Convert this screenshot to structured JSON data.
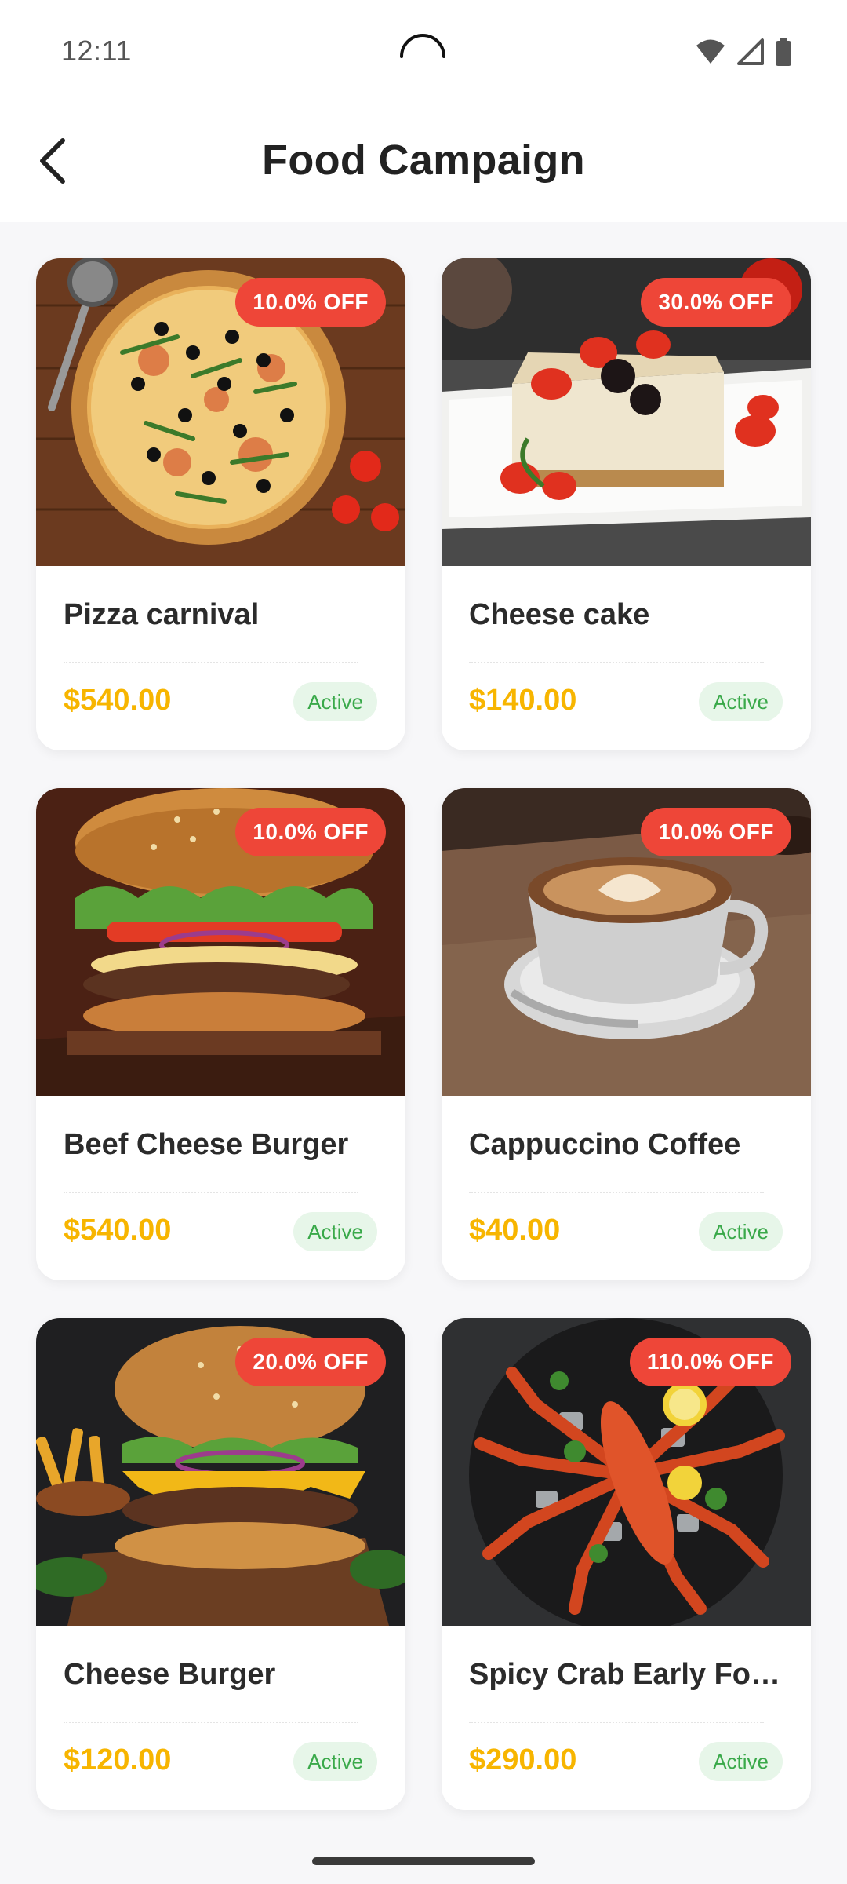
{
  "status_bar": {
    "time": "12:11",
    "icons": [
      "wifi-icon",
      "signal-icon",
      "battery-icon"
    ]
  },
  "header": {
    "title": "Food Campaign",
    "back_icon": "back-arrow-icon"
  },
  "colors": {
    "discount_badge": "#ee4638",
    "price": "#f7b500",
    "status_text": "#3aa94a",
    "status_bg": "#e7f6e9"
  },
  "campaigns": [
    {
      "name": "Pizza carnival",
      "discount": "10.0% OFF",
      "price": "$540.00",
      "status": "Active",
      "image": "pizza-image"
    },
    {
      "name": "Cheese cake",
      "discount": "30.0% OFF",
      "price": "$140.00",
      "status": "Active",
      "image": "cheesecake-image"
    },
    {
      "name": "Beef Cheese Burger",
      "discount": "10.0% OFF",
      "price": "$540.00",
      "status": "Active",
      "image": "burger-image"
    },
    {
      "name": "Cappuccino Coffee",
      "discount": "10.0% OFF",
      "price": "$40.00",
      "status": "Active",
      "image": "coffee-image"
    },
    {
      "name": "Cheese Burger",
      "discount": "20.0% OFF",
      "price": "$120.00",
      "status": "Active",
      "image": "cheese-burger-image"
    },
    {
      "name": "Spicy Crab Early Fo…",
      "discount": "110.0% OFF",
      "price": "$290.00",
      "status": "Active",
      "image": "crab-image"
    }
  ]
}
